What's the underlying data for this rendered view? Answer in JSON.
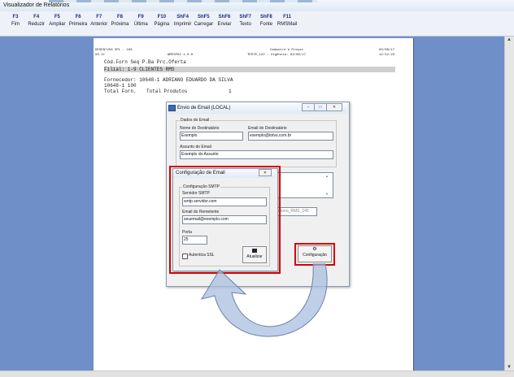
{
  "app": {
    "title": "Visualizador de Relatórios"
  },
  "toolbar": [
    {
      "key": "F3",
      "label": "Fim"
    },
    {
      "key": "F4",
      "label": "Reduzir"
    },
    {
      "key": "F5",
      "label": "Ampliar"
    },
    {
      "key": "F6",
      "label": "Primeira"
    },
    {
      "key": "F7",
      "label": "Anterior"
    },
    {
      "key": "F8",
      "label": "Próxima"
    },
    {
      "key": "F9",
      "label": "Última"
    },
    {
      "key": "F10",
      "label": "Página"
    },
    {
      "key": "ShF4",
      "label": "Imprimir"
    },
    {
      "key": "ShF5",
      "label": "Carregar"
    },
    {
      "key": "ShF6",
      "label": "Enviar"
    },
    {
      "key": "ShF7",
      "label": "Texto"
    },
    {
      "key": "ShF8",
      "label": "Fonte"
    },
    {
      "key": "F11",
      "label": "RMSMail"
    }
  ],
  "report": {
    "header_left_1": "DESEN*V58 SPL - 106",
    "header_left_2": "03.2r",
    "header_mid": "WRESP02 1.0.0",
    "header_right_1": "Cadastro e Preços",
    "header_date_1": "03/08/17",
    "header_right_2": "TESTE_122 - Vigência: 03/08/17",
    "header_time": "12:52:23",
    "cols": "Cód.Forn  Seq P.Ba  Prc.Oferta",
    "filial": "Filial:  1-9  CLIENTES RMS",
    "fornecedor": "Fornecedor:      10648-1 ADRIANO EDUARDO DA SILVA",
    "line2": "  10648-1  100",
    "total_forn": "Total Forn.",
    "total_produtos": "Total Produtos",
    "total_value": "1"
  },
  "email_dialog": {
    "title": "Envio de Email (LOCAL)",
    "group_label": "Dados do Email",
    "nome_label": "Nome do Destinatário",
    "nome_value": "Exemplo",
    "email_dest_label": "Email do Destinatário",
    "email_dest_value": "exemplo@totvs.com.br",
    "assunto_label": "Assunto do Email",
    "assunto_value": "Exemplo do Assunto",
    "attachment_fragment": "latorio_RMS_245",
    "config_button_label": "Configuração"
  },
  "config_dialog": {
    "title": "Configuração de Email",
    "group_label": "Configuração SMTP",
    "servidor_label": "Servidor SMTP",
    "servidor_value": "smtp.servidor.com",
    "remetente_label": "Email do Remetente",
    "remetente_value": "seuemail@exemplo.com",
    "porta_label": "Porta",
    "porta_value": "25",
    "ssl_label": "Autentica SSL",
    "atualizar_label": "Atualizar"
  },
  "colors": {
    "highlight": "#d80000",
    "workspace": "#6f8fc8",
    "arrow": "#a9bfe0"
  }
}
